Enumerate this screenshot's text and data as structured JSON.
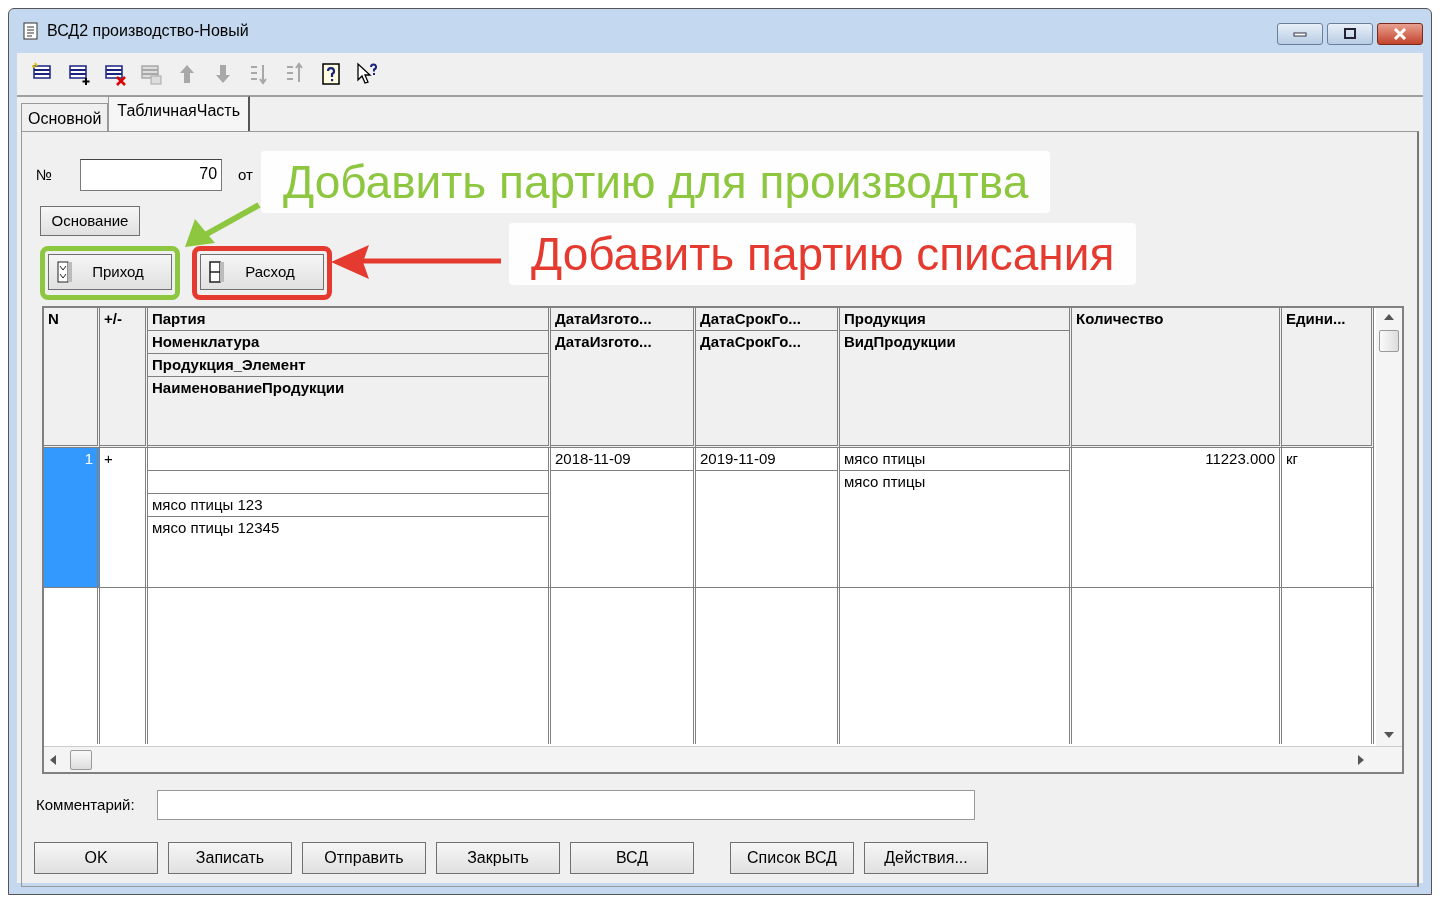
{
  "window": {
    "title": "ВСД2 производство-Новый"
  },
  "toolbar": [
    {
      "kind": "new",
      "disabled": false
    },
    {
      "kind": "add-row",
      "disabled": false
    },
    {
      "kind": "delete-row",
      "disabled": false
    },
    {
      "kind": "copy",
      "disabled": true
    },
    {
      "kind": "up",
      "disabled": true
    },
    {
      "kind": "down",
      "disabled": true
    },
    {
      "kind": "sort-asc",
      "disabled": true
    },
    {
      "kind": "sort-desc",
      "disabled": true
    },
    {
      "kind": "help",
      "disabled": false
    },
    {
      "kind": "whatsthis",
      "disabled": false
    }
  ],
  "tabs": [
    {
      "label": "Основной",
      "selected": false
    },
    {
      "label": "ТабличнаяЧасть",
      "selected": true
    }
  ],
  "form": {
    "number_label": "№",
    "number": "70",
    "date_label": "от",
    "basis_button": "Основание"
  },
  "line_buttons": [
    {
      "label": "Приход",
      "kind": "income",
      "color": "#8dc63f"
    },
    {
      "label": "Расход",
      "kind": "expense",
      "color": "#e53a2f"
    }
  ],
  "table": {
    "columns": [
      {
        "lines": [
          "N"
        ]
      },
      {
        "lines": [
          "+/-"
        ]
      },
      {
        "lines": [
          "Партия",
          "Номенклатура",
          "Продукция_Элемент",
          "НаименованиеПродукции"
        ]
      },
      {
        "lines": [
          "ДатаИзгото...",
          "ДатаИзгото..."
        ]
      },
      {
        "lines": [
          "ДатаСрокГо...",
          "ДатаСрокГо..."
        ]
      },
      {
        "lines": [
          "Продукция",
          "ВидПродукции"
        ]
      },
      {
        "lines": [
          "Количество"
        ],
        "kind": "numeric"
      },
      {
        "lines": [
          "Едини..."
        ]
      }
    ],
    "rows": [
      {
        "selected": true,
        "cells": [
          [
            "1"
          ],
          [
            "+"
          ],
          [
            null,
            null,
            "мясо птицы 123",
            "мясо птицы 12345"
          ],
          [
            "2018-11-09",
            null
          ],
          [
            "2019-11-09",
            null
          ],
          [
            "мясо птицы",
            "мясо птицы"
          ],
          [
            "11223.000"
          ],
          [
            "кг"
          ]
        ]
      }
    ]
  },
  "comment": {
    "label": "Комментарий:"
  },
  "buttons": [
    "OK",
    "Записать",
    "Отправить",
    "Закрыть",
    "ВСД",
    "Список ВСД",
    "Действия..."
  ],
  "callouts": [
    {
      "text": "Добавить партию для производтва",
      "color": "#8dc63f"
    },
    {
      "text": "Добавить партию списания",
      "color": "#e53a2f"
    }
  ]
}
